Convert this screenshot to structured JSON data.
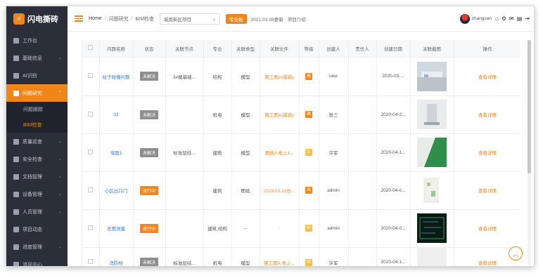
{
  "app": {
    "logo_text": "闪电撕砖"
  },
  "sidebar": {
    "items": [
      {
        "label": "工作台",
        "chevron": false,
        "active": false
      },
      {
        "label": "基础信息",
        "chevron": true,
        "active": false
      },
      {
        "label": "AI识别",
        "chevron": false,
        "active": false
      },
      {
        "label": "问题研究",
        "chevron": true,
        "active": true
      },
      {
        "label": "质量巡查",
        "chevron": true,
        "active": false
      },
      {
        "label": "安全检查",
        "chevron": true,
        "active": false
      },
      {
        "label": "文档管理",
        "chevron": true,
        "active": false
      },
      {
        "label": "设备管理",
        "chevron": true,
        "active": false
      },
      {
        "label": "人员管理",
        "chevron": true,
        "active": false
      },
      {
        "label": "项目动态",
        "chevron": false,
        "active": false
      },
      {
        "label": "进度管理",
        "chevron": true,
        "active": false
      },
      {
        "label": "消息中心",
        "chevron": false,
        "active": false
      }
    ],
    "subitems": [
      {
        "label": "问题跟踪",
        "active": false
      },
      {
        "label": "BIM检查",
        "active": true
      }
    ]
  },
  "topbar": {
    "breadcrumb": [
      "Home",
      "问题研究",
      "BIM检查"
    ],
    "project_select": "城南新区项目",
    "tag": "专业板",
    "date": "2021-03-08更新",
    "intro": "项目介绍",
    "username": "zhangsan"
  },
  "table": {
    "headers": [
      "",
      "问题名称",
      "状态",
      "关联节点",
      "专业",
      "关联类型",
      "关联文件",
      "等级",
      "创建人",
      "责任人",
      "创建日期",
      "关联截图",
      "操作"
    ],
    "rows": [
      {
        "name": "柱子碰撞问题",
        "status": "未解决",
        "status_type": "gray",
        "node": "3#楼基础...",
        "major": "结构",
        "type": "模型",
        "file": "施工图A(最新)",
        "level": "高",
        "level_type": "h",
        "creator": "luke",
        "owner": "",
        "date": "2020-03-...",
        "photo": "p1",
        "op": "查看详情"
      },
      {
        "name": "33",
        "status": "未解决",
        "status_type": "gray",
        "node": "",
        "major": "机电",
        "type": "模型",
        "file": "施工图A(最新)",
        "level": "高",
        "level_type": "h",
        "creator": "张三",
        "owner": "",
        "date": "2020-04-2...",
        "photo": "p2",
        "op": "查看详情"
      },
      {
        "name": "墙面1",
        "status": "未解决",
        "status_type": "gray",
        "node": "标准层结...",
        "major": "建筑",
        "type": "模型",
        "file": "图纸A 地上1...",
        "level": "中",
        "level_type": "l",
        "creator": "许军",
        "owner": "",
        "date": "2020-04-1...",
        "photo": "p3",
        "op": "查看详情"
      },
      {
        "name": "小区出口门",
        "status": "进行中",
        "status_type": "orange",
        "node": "",
        "major": "建筑",
        "type": "图纸",
        "file": "2019.03.13总...",
        "level": "高",
        "level_type": "h",
        "creator": "admin",
        "owner": "",
        "date": "2020-04-0...",
        "photo": "p4",
        "op": "查看详情"
      },
      {
        "name": "总图测量",
        "status": "进行中",
        "status_type": "orange",
        "node": "",
        "major": "建筑,结构",
        "type": "--",
        "file": "-",
        "level": "中",
        "level_type": "l",
        "creator": "admin",
        "owner": "",
        "date": "2020-04-0...",
        "photo": "p5",
        "op": "查看详情"
      },
      {
        "name": "消防栓",
        "status": "未解决",
        "status_type": "gray",
        "node": "标准层结...",
        "major": "机电",
        "type": "模型",
        "file": "施工图A 地上...",
        "level": "中",
        "level_type": "l",
        "creator": "许军",
        "owner": "",
        "date": "2020-04-1...",
        "photo": "p6",
        "op": "查看详情"
      }
    ]
  }
}
